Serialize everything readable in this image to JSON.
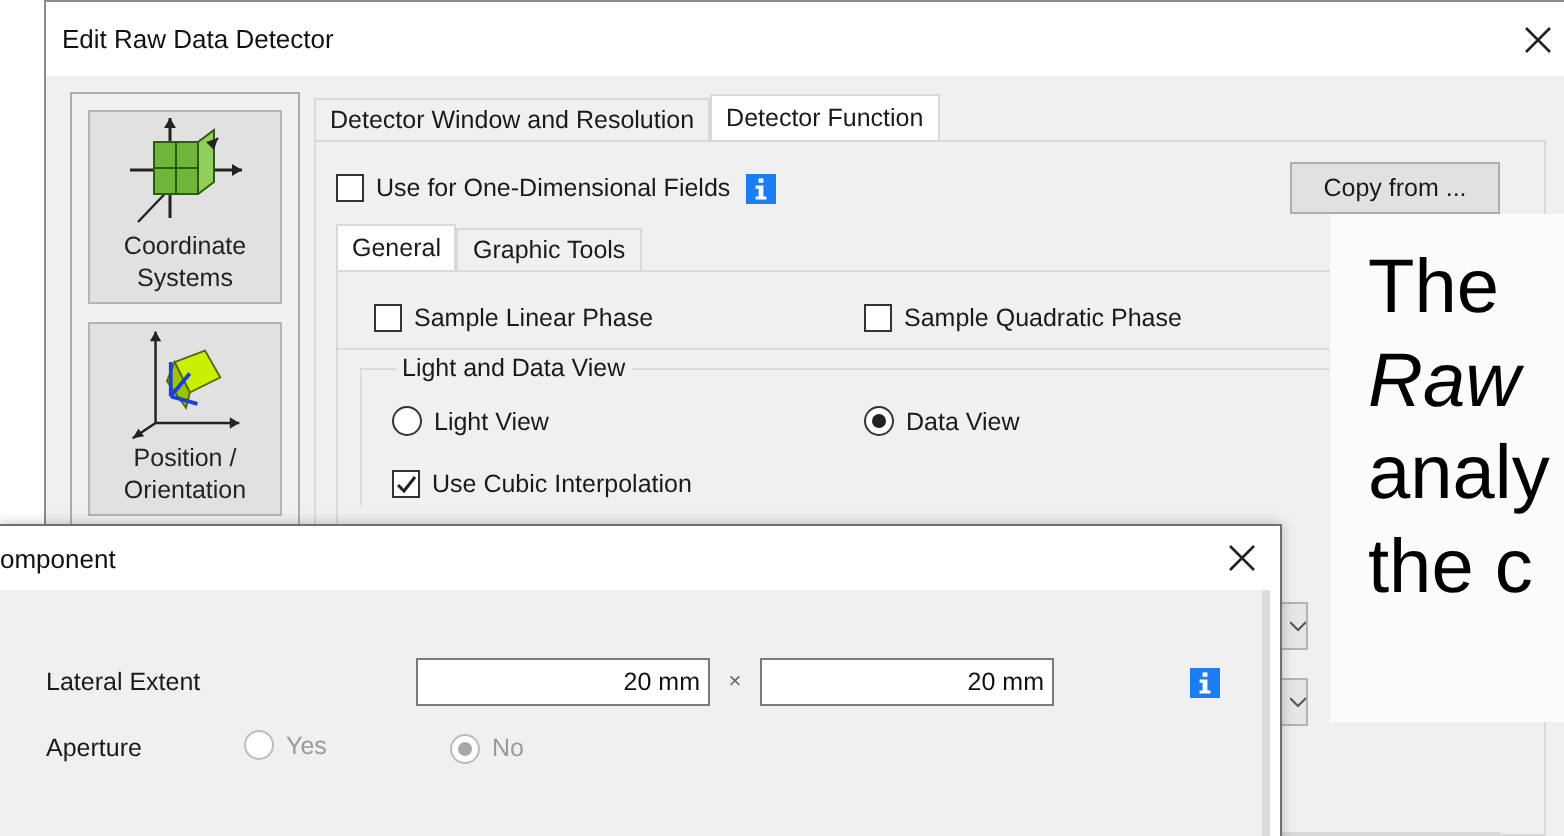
{
  "editor_window": {
    "title": "Edit Raw Data Detector",
    "sidebar": [
      {
        "label": "Coordinate Systems",
        "kind": "axes"
      },
      {
        "label": "Position / Orientation",
        "kind": "position"
      }
    ],
    "tabs": [
      {
        "label": "Detector Window and Resolution",
        "selected": false
      },
      {
        "label": "Detector Function",
        "selected": true
      }
    ],
    "one_dimensional": {
      "label": "Use for One-Dimensional Fields",
      "checked": false
    },
    "copy_button": "Copy from ...",
    "subtabs": [
      {
        "label": "General",
        "selected": true
      },
      {
        "label": "Graphic Tools",
        "selected": false
      }
    ],
    "phase_options": [
      {
        "label": "Sample Linear Phase",
        "checked": false
      },
      {
        "label": "Sample Quadratic Phase",
        "checked": false
      }
    ],
    "view_group": {
      "title": "Light and Data View",
      "views": [
        {
          "label": "Light View",
          "selected": false
        },
        {
          "label": "Data View",
          "selected": true
        }
      ],
      "cubic_interpolation": {
        "label": "Use Cubic Interpolation",
        "checked": true
      }
    }
  },
  "slide_text": {
    "lines": [
      "The",
      "*Raw*",
      "analy",
      "the c"
    ]
  },
  "component_dialog": {
    "title": "omponent",
    "lateral_extent": {
      "label": "Lateral Extent",
      "x": "20 mm",
      "separator": "×",
      "y": "20 mm"
    },
    "aperture": {
      "label": "Aperture",
      "disabled": true,
      "options": [
        {
          "label": "Yes",
          "selected": false
        },
        {
          "label": "No",
          "selected": true
        }
      ]
    }
  }
}
